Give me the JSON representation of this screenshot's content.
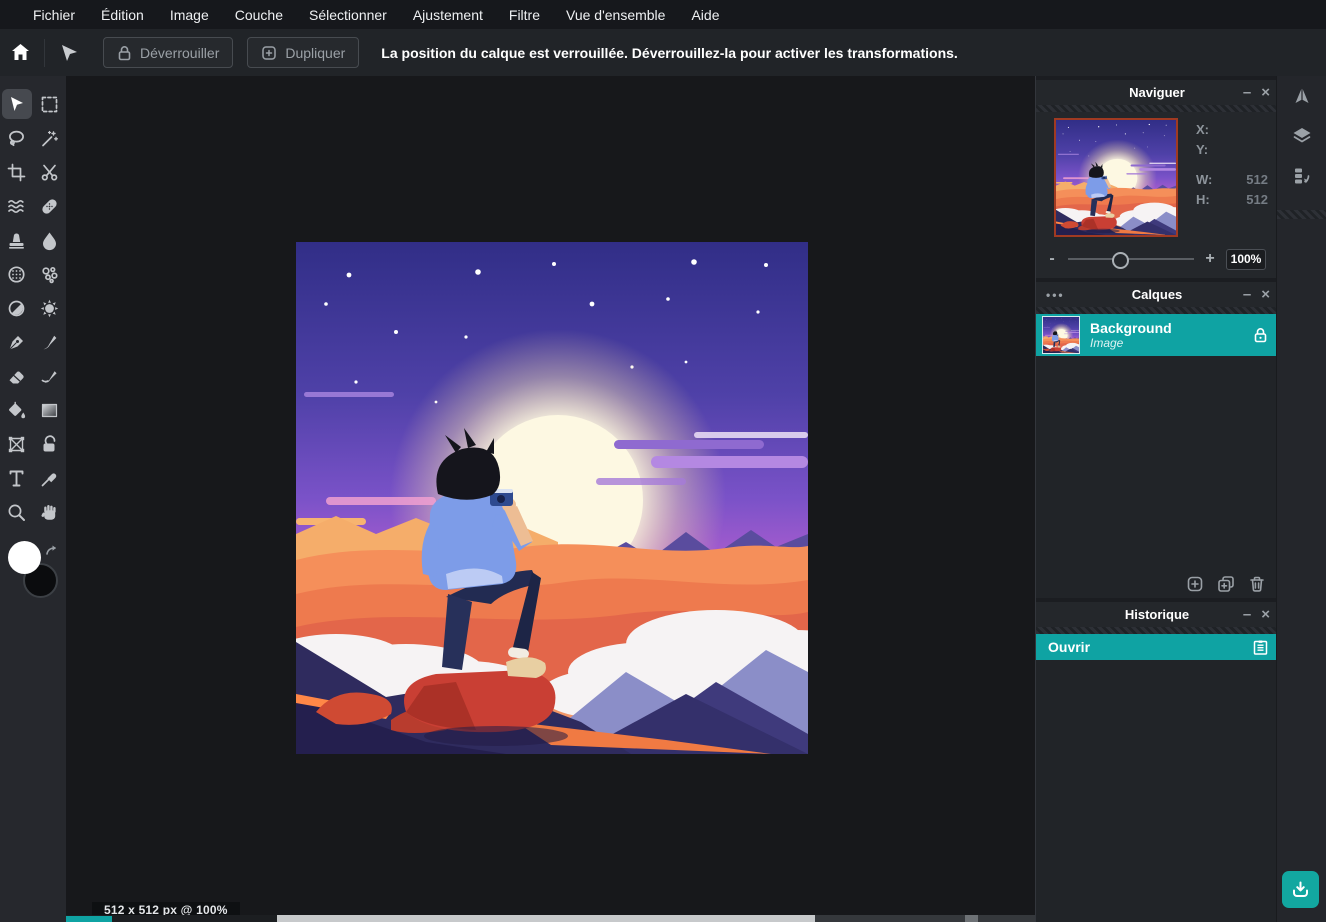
{
  "menu": {
    "items": [
      "Fichier",
      "Édition",
      "Image",
      "Couche",
      "Sélectionner",
      "Ajustement",
      "Filtre",
      "Vue d'ensemble",
      "Aide"
    ]
  },
  "toolbar": {
    "unlock_label": "Déverrouiller",
    "duplicate_label": "Dupliquer",
    "message": "La position du calque est verrouillée. Déverrouillez-la pour activer les transformations."
  },
  "tools": {
    "left_palette": [
      "move",
      "marquee-select",
      "lasso",
      "magic-wand",
      "crop",
      "slice",
      "liquify",
      "healing-brush",
      "clone-stamp",
      "blur",
      "sphere-warp",
      "particles",
      "dodge-burn",
      "sharpen",
      "pen",
      "brush",
      "eraser",
      "mixer-brush",
      "paint-bucket",
      "gradient",
      "free-transform",
      "shape",
      "text",
      "eyedropper",
      "zoom",
      "hand"
    ],
    "selected": "move",
    "right_strip": [
      "navigator",
      "layers",
      "history"
    ]
  },
  "navigator": {
    "title": "Naviguer",
    "x_label": "X:",
    "x_value": "",
    "y_label": "Y:",
    "y_value": "",
    "w_label": "W:",
    "w_value": "512",
    "h_label": "H:",
    "h_value": "512",
    "zoom_minus": "-",
    "zoom_plus": "+",
    "zoom_value": "100%"
  },
  "layers": {
    "title": "Calques",
    "menu_dots": "•••",
    "layer_name": "Background",
    "layer_type": "Image",
    "locked": true
  },
  "history": {
    "title": "Historique",
    "entry": "Ouvrir"
  },
  "status": {
    "text": "512 x 512 px @ 100%"
  },
  "icons": {
    "minimize": "–",
    "close": "×"
  },
  "colors": {
    "accent_teal": "#0fa3a3",
    "thumbnail_border": "#a03a22",
    "panel_bg": "#24272b",
    "canvas_bg": "#17181b"
  }
}
